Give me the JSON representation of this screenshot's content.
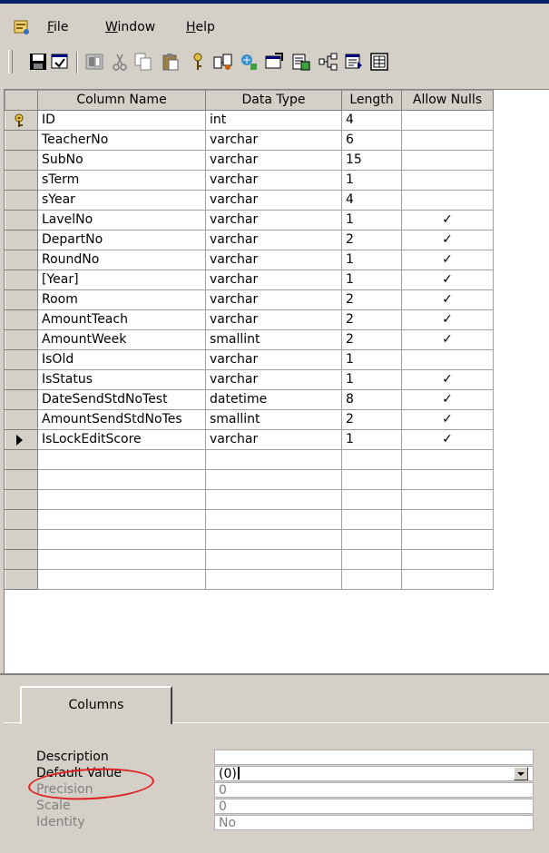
{
  "menu": [
    {
      "label": "File",
      "mnemonic": "F",
      "rest": "ile"
    },
    {
      "label": "Window",
      "mnemonic": "W",
      "rest": "indow"
    },
    {
      "label": "Help",
      "mnemonic": "H",
      "rest": "elp"
    }
  ],
  "toolbar": {
    "buttons": [
      "save-icon",
      "properties-icon",
      "insert-column-icon",
      "cut-icon",
      "copy-icon",
      "paste-icon",
      "primary-key-icon",
      "manage-relationships-icon",
      "manage-indexes-icon",
      "check-constraints-icon",
      "generate-script-icon",
      "relationship-diagram-icon",
      "tables-icon",
      "grid-icon"
    ]
  },
  "grid": {
    "headers": {
      "name": "Column Name",
      "type": "Data Type",
      "length": "Length",
      "nulls": "Allow Nulls"
    },
    "rows": [
      {
        "name": "ID",
        "type": "int",
        "length": "4",
        "nulls": "",
        "marker": "key"
      },
      {
        "name": "TeacherNo",
        "type": "varchar",
        "length": "6",
        "nulls": "",
        "marker": ""
      },
      {
        "name": "SubNo",
        "type": "varchar",
        "length": "15",
        "nulls": "",
        "marker": ""
      },
      {
        "name": "sTerm",
        "type": "varchar",
        "length": "1",
        "nulls": "",
        "marker": ""
      },
      {
        "name": "sYear",
        "type": "varchar",
        "length": "4",
        "nulls": "",
        "marker": ""
      },
      {
        "name": "LavelNo",
        "type": "varchar",
        "length": "1",
        "nulls": "✓",
        "marker": ""
      },
      {
        "name": "DepartNo",
        "type": "varchar",
        "length": "2",
        "nulls": "✓",
        "marker": ""
      },
      {
        "name": "RoundNo",
        "type": "varchar",
        "length": "1",
        "nulls": "✓",
        "marker": ""
      },
      {
        "name": "[Year]",
        "type": "varchar",
        "length": "1",
        "nulls": "✓",
        "marker": ""
      },
      {
        "name": "Room",
        "type": "varchar",
        "length": "2",
        "nulls": "✓",
        "marker": ""
      },
      {
        "name": "AmountTeach",
        "type": "varchar",
        "length": "2",
        "nulls": "✓",
        "marker": ""
      },
      {
        "name": "AmountWeek",
        "type": "smallint",
        "length": "2",
        "nulls": "✓",
        "marker": ""
      },
      {
        "name": "IsOld",
        "type": "varchar",
        "length": "1",
        "nulls": "",
        "marker": ""
      },
      {
        "name": "IsStatus",
        "type": "varchar",
        "length": "1",
        "nulls": "✓",
        "marker": ""
      },
      {
        "name": "DateSendStdNoTest",
        "type": "datetime",
        "length": "8",
        "nulls": "✓",
        "marker": ""
      },
      {
        "name": "AmountSendStdNoTes",
        "type": "smallint",
        "length": "2",
        "nulls": "✓",
        "marker": ""
      },
      {
        "name": "IsLockEditScore",
        "type": "varchar",
        "length": "1",
        "nulls": "✓",
        "marker": "current"
      }
    ],
    "empty_rows": 7
  },
  "properties": {
    "tab": "Columns",
    "items": [
      {
        "label": "Description",
        "value": "",
        "dim": false
      },
      {
        "label": "Default Value",
        "value": "(0)",
        "dim": false
      },
      {
        "label": "Precision",
        "value": "0",
        "dim": true
      },
      {
        "label": "Scale",
        "value": "0",
        "dim": true
      },
      {
        "label": "Identity",
        "value": "No",
        "dim": true
      }
    ]
  },
  "colors": {
    "chrome": "#d4d0c8",
    "annotation": "#e02020",
    "titlebar": "#0a246a"
  }
}
